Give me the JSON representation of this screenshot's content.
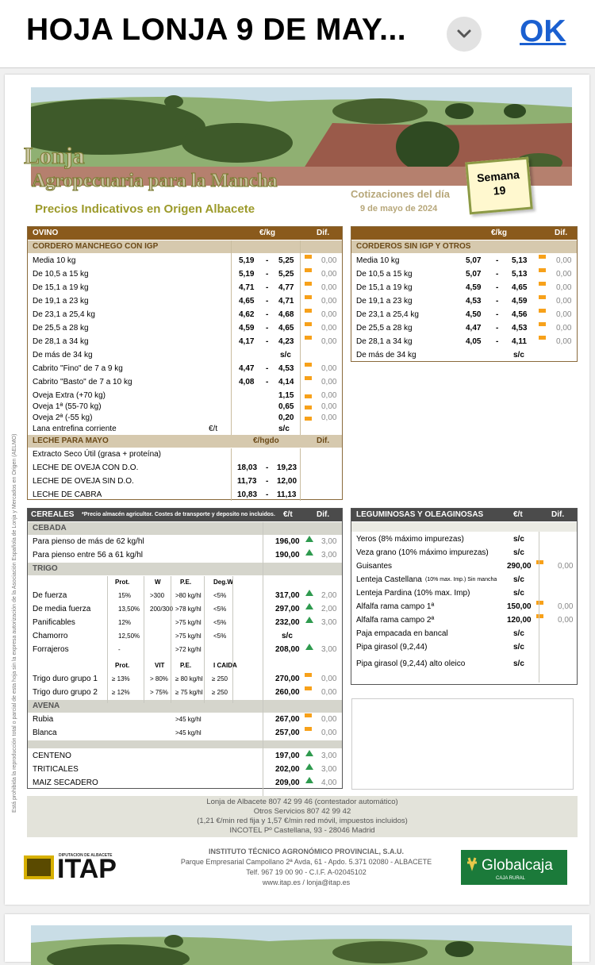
{
  "header": {
    "title": "HOJA LONJA 9 DE MAY...",
    "ok": "OK"
  },
  "doc": {
    "logo_lines": [
      "Lonja",
      "Agropecuaria para la Mancha"
    ],
    "subtitle": "Precios Indicativos en Origen Albacete",
    "cotiz_title": "Cotizaciones del día",
    "cotiz_date": "9 de mayo de 2024",
    "semana_label": "Semana",
    "semana_num": "19",
    "side_text": "Está prohibida la reproducción total o parcial de esta hoja sin la expresa autorización de la Asociación Española de Lonja y Mercados en Origen (AELMO)"
  },
  "ovino": {
    "title": "OVINO",
    "unit": "€/kg",
    "dif": "Dif.",
    "section": "CORDERO MANCHEGO CON IGP",
    "rows": [
      {
        "label": "Media 10 kg",
        "min": "5,19",
        "max": "5,25",
        "dif": "0,00"
      },
      {
        "label": "De 10,5 a 15 kg",
        "min": "5,19",
        "max": "5,25",
        "dif": "0,00"
      },
      {
        "label": "De 15,1 a 19 kg",
        "min": "4,71",
        "max": "4,77",
        "dif": "0,00"
      },
      {
        "label": "De 19,1 a 23 kg",
        "min": "4,65",
        "max": "4,71",
        "dif": "0,00"
      },
      {
        "label": "De 23,1 a 25,4 kg",
        "min": "4,62",
        "max": "4,68",
        "dif": "0,00"
      },
      {
        "label": "De 25,5 a 28 kg",
        "min": "4,59",
        "max": "4,65",
        "dif": "0,00"
      },
      {
        "label": "De 28,1 a 34 kg",
        "min": "4,17",
        "max": "4,23",
        "dif": "0,00"
      },
      {
        "label": "De más de 34 kg",
        "sc": "s/c"
      }
    ],
    "cabrito": [
      {
        "label": "Cabrito \"Fino\" de 7 a 9 kg",
        "min": "4,47",
        "max": "4,53",
        "dif": "0,00"
      },
      {
        "label": "Cabrito \"Basto\" de 7 a 10 kg",
        "min": "4,08",
        "max": "4,14",
        "dif": "0,00"
      }
    ],
    "oveja": [
      {
        "label": "Oveja Extra (+70 kg)",
        "val": "1,15",
        "dif": "0,00"
      },
      {
        "label": "Oveja 1ª (55-70 kg)",
        "val": "0,65",
        "dif": "0,00"
      },
      {
        "label": "Oveja 2ª (-55 kg)",
        "val": "0,20",
        "dif": "0,00"
      },
      {
        "label": "Lana entrefina corriente",
        "unit": "€/t",
        "val": "s/c"
      }
    ],
    "leche_title": "LECHE PARA MAYO",
    "leche_unit": "€/hgdo",
    "leche_dif": "Dif.",
    "leche": [
      {
        "label": "Extracto Seco Útil (grasa + proteína)"
      },
      {
        "label": "LECHE DE OVEJA CON D.O.",
        "min": "18,03",
        "max": "19,23"
      },
      {
        "label": "LECHE DE OVEJA SIN D.O.",
        "min": "11,73",
        "max": "12,00"
      },
      {
        "label": "LECHE DE CABRA",
        "min": "10,83",
        "max": "11,13"
      }
    ]
  },
  "corderos": {
    "title": "CORDEROS SIN IGP Y OTROS",
    "unit": "€/kg",
    "dif": "Dif.",
    "rows": [
      {
        "label": "Media 10 kg",
        "min": "5,07",
        "max": "5,13",
        "dif": "0,00"
      },
      {
        "label": "De 10,5 a 15 kg",
        "min": "5,07",
        "max": "5,13",
        "dif": "0,00"
      },
      {
        "label": "De 15,1 a 19 kg",
        "min": "4,59",
        "max": "4,65",
        "dif": "0,00"
      },
      {
        "label": "De 19,1 a 23 kg",
        "min": "4,53",
        "max": "4,59",
        "dif": "0,00"
      },
      {
        "label": "De 23,1 a 25,4 kg",
        "min": "4,50",
        "max": "4,56",
        "dif": "0,00"
      },
      {
        "label": "De 25,5 a 28 kg",
        "min": "4,47",
        "max": "4,53",
        "dif": "0,00"
      },
      {
        "label": "De 28,1 a 34 kg",
        "min": "4,05",
        "max": "4,11",
        "dif": "0,00"
      },
      {
        "label": "De más de 34 kg",
        "sc": "s/c"
      }
    ]
  },
  "cereales": {
    "title": "CEREALES",
    "note": "*Precio almacén agricultor. Costes de transporte y deposito no incluidos.",
    "unit": "€/t",
    "dif": "Dif.",
    "cebada": "CEBADA",
    "cebada_rows": [
      {
        "label": "Para pienso de más de 62 kg/hl",
        "val": "196,00",
        "dif": "3,00"
      },
      {
        "label": "Para pienso entre 56 a 61 kg/hl",
        "val": "190,00",
        "dif": "3,00"
      }
    ],
    "trigo": "TRIGO",
    "trigo_cols": [
      "Prot.",
      "W",
      "P.E.",
      "Deg.W"
    ],
    "trigo_rows": [
      {
        "label": "De fuerza",
        "prot": "15%",
        "w": ">300",
        "pe": ">80 kg/hl",
        "deg": "<5%",
        "val": "317,00",
        "dif": "2,00",
        "up": true
      },
      {
        "label": "De media fuerza",
        "prot": "13,50%",
        "w": "200/300",
        "pe": ">78 kg/hl",
        "deg": "<5%",
        "val": "297,00",
        "dif": "2,00",
        "up": true
      },
      {
        "label": "Panificables",
        "prot": "12%",
        "w": "",
        "pe": ">75 kg/hl",
        "deg": "<5%",
        "val": "232,00",
        "dif": "3,00",
        "up": true
      },
      {
        "label": "Chamorro",
        "prot": "12,50%",
        "w": "",
        "pe": ">75 kg/hl",
        "deg": "<5%",
        "val": "s/c"
      },
      {
        "label": "Forrajeros",
        "prot": "-",
        "w": "",
        "pe": ">72 kg/hl",
        "deg": "",
        "val": "208,00",
        "dif": "3,00",
        "up": true
      }
    ],
    "duro_cols": [
      "Prot.",
      "VIT",
      "P.E.",
      "I CAIDA"
    ],
    "duro_rows": [
      {
        "label": "Trigo duro grupo 1",
        "prot": "≥ 13%",
        "w": "> 80%",
        "pe": "≥ 80 kg/hl",
        "deg": "≥ 250",
        "val": "270,00",
        "dif": "0,00"
      },
      {
        "label": "Trigo duro grupo 2",
        "prot": "≥ 12%",
        "w": "> 75%",
        "pe": "≥ 75 kg/hl",
        "deg": "≥ 250",
        "val": "260,00",
        "dif": "0,00"
      }
    ],
    "avena": "AVENA",
    "avena_rows": [
      {
        "label": "Rubia",
        "pe": ">45 kg/hl",
        "val": "267,00",
        "dif": "0,00"
      },
      {
        "label": "Blanca",
        "pe": ">45 kg/hl",
        "val": "257,00",
        "dif": "0,00"
      }
    ],
    "otros": [
      {
        "label": "CENTENO",
        "val": "197,00",
        "dif": "3,00",
        "up": true
      },
      {
        "label": "TRITICALES",
        "val": "202,00",
        "dif": "3,00",
        "up": true
      },
      {
        "label": "MAIZ SECADERO",
        "val": "209,00",
        "dif": "4,00",
        "up": true
      }
    ]
  },
  "legum": {
    "title": "LEGUMINOSAS Y OLEAGINOSAS",
    "unit": "€/t",
    "dif": "Dif.",
    "rows": [
      {
        "label": "Yeros (8% máximo impurezas)",
        "val": "s/c"
      },
      {
        "label": "Veza grano (10% máximo impurezas)",
        "val": "s/c"
      },
      {
        "label": "Guisantes",
        "val": "290,00",
        "dif": "0,00"
      },
      {
        "label": "Lenteja Castellana",
        "note": "(10% max. Imp.) Sin mancha",
        "val": "s/c"
      },
      {
        "label": "Lenteja Pardina (10% max. Imp)",
        "val": "s/c"
      },
      {
        "label": "Alfalfa rama campo 1ª",
        "val": "150,00",
        "dif": "0,00"
      },
      {
        "label": "Alfalfa rama campo 2ª",
        "val": "120,00",
        "dif": "0,00"
      },
      {
        "label": "Paja empacada en bancal",
        "val": "s/c"
      },
      {
        "label": "Pipa girasol (9,2,44)",
        "val": "s/c"
      },
      {
        "label": "Pipa girasol (9,2,44) alto oleico",
        "val": "s/c"
      }
    ]
  },
  "footer": {
    "lines": [
      "Lonja de Albacete 807 42 99 46 (contestador automático)",
      "Otros Servicios 807 42 99 42",
      "(1,21 €/min red fija y 1,57 €/min red móvil, impuestos incluidos)",
      "INCOTEL Pº Castellana, 93 - 28046 Madrid"
    ],
    "inst": [
      "INSTITUTO TÉCNICO AGRONÓMICO PROVINCIAL, S.A.U.",
      "Parque Empresarial Campollano 2ª Avda, 61 - Apdo. 5.371   02080 - ALBACETE",
      "Telf. 967 19 00 90 -  C.I.F. A-02045102",
      "www.itap.es / lonja@itap.es"
    ],
    "itap": "ITAP",
    "diputacion": "DIPUTACION DE ALBACETE",
    "globalcaja": "Globalcaja",
    "caja_rural": "CAJA RURAL"
  }
}
